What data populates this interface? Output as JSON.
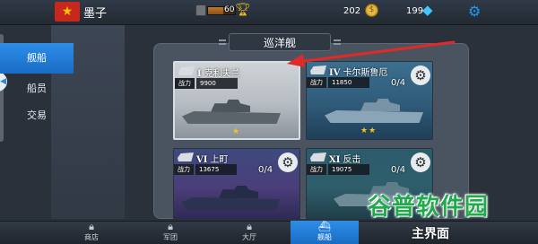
{
  "header": {
    "player_name": "墨子",
    "rank_value": "60",
    "rank_progress": 0.55,
    "gold": "202",
    "gems": "199",
    "icons": {
      "flag": "china-flag-icon",
      "rank": "rank-badge-icon",
      "trophy": "trophy-icon",
      "coin": "gold-coin-icon",
      "diamond": "diamond-icon",
      "settings": "gear-icon"
    }
  },
  "sidebar": {
    "items": [
      {
        "label": "舰船",
        "active": true
      },
      {
        "label": "船员",
        "active": false
      },
      {
        "label": "交易",
        "active": false
      }
    ]
  },
  "panel": {
    "title": "巡洋舰"
  },
  "ships": [
    {
      "tier": "I",
      "name": "克利夫兰",
      "power_label": "战力",
      "power": "9900",
      "count": "",
      "stars": "★",
      "selected": true
    },
    {
      "tier": "IV",
      "name": "卡尔斯鲁厄",
      "power_label": "战力",
      "power": "11850",
      "count": "0/4",
      "stars": "★★",
      "selected": false
    },
    {
      "tier": "VI",
      "name": "上町",
      "power_label": "战力",
      "power": "13675",
      "count": "0/4",
      "stars": "",
      "selected": false
    },
    {
      "tier": "XI",
      "name": "反击",
      "power_label": "战力",
      "power": "19075",
      "count": "0/4",
      "stars": "",
      "selected": false
    }
  ],
  "bottom_nav": {
    "items": [
      {
        "label": "商店",
        "icon": "lock-icon",
        "active": false
      },
      {
        "label": "军团",
        "icon": "lock-icon",
        "active": false
      },
      {
        "label": "大厅",
        "icon": "lock-icon",
        "active": false
      },
      {
        "label": "舰船",
        "icon": "ship-icon",
        "active": true
      }
    ],
    "main_button": "主界面"
  },
  "watermark": "谷普软件园",
  "colors": {
    "accent": "#1a7ee0",
    "annotation_arrow": "#e02a2a",
    "watermark_green": "#1faa4b",
    "star": "#f0c419"
  }
}
